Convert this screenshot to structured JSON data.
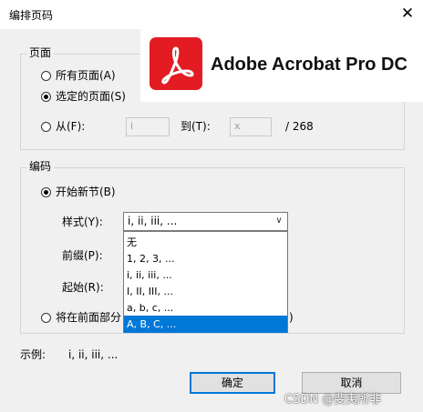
{
  "window": {
    "title": "编排页码",
    "close_glyph": "✕"
  },
  "pages_group": {
    "legend": "页面",
    "all_label": "所有页面(A)",
    "selected_label": "选定的页面(S)",
    "from_label": "从(F):",
    "from_value": "i",
    "to_label": "到(T):",
    "to_value": "x",
    "total": "/ 268",
    "checked": "selected"
  },
  "numbering_group": {
    "legend": "编码",
    "new_section_label": "开始新节(B)",
    "style_label": "样式(Y):",
    "style_value": "i, ii, iii, ...",
    "prefix_label": "前缀(P):",
    "start_label": "起始(R):",
    "extend_label": "将在前面部分",
    "extend_suffix": ")",
    "style_options": [
      "无",
      "1, 2, 3, ...",
      "i, ii, iii, ...",
      "I, II, III, ...",
      "a, b, c, ...",
      "A, B, C, ..."
    ],
    "highlighted_option": "A, B, C, ..."
  },
  "example": {
    "label": "示例:",
    "value": "i, ii, iii, ..."
  },
  "buttons": {
    "ok": "确定",
    "cancel": "取消"
  },
  "banner": {
    "text": "Adobe Acrobat Pro DC",
    "logo_color": "#e31b23"
  },
  "watermark": "CSDN @斐夷所非",
  "colors": {
    "accent": "#0078d7",
    "dialog_bg": "#f0f0f0"
  }
}
